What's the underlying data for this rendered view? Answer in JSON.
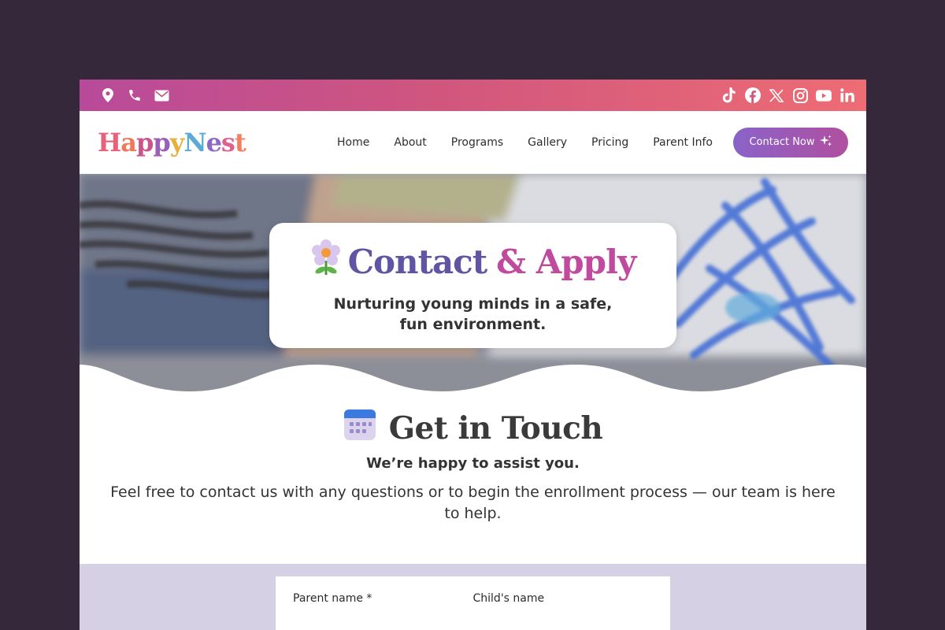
{
  "topbar": {
    "left_icons": [
      "location-pin-icon",
      "phone-icon",
      "mail-icon"
    ],
    "right_icons": [
      "tiktok-icon",
      "facebook-icon",
      "x-icon",
      "instagram-icon",
      "youtube-icon",
      "linkedin-icon"
    ]
  },
  "logo": {
    "letters": [
      "H",
      "a",
      "p",
      "p",
      "y",
      "N",
      "e",
      "s",
      "t"
    ],
    "colors": [
      "#e8607a",
      "#ee7a5a",
      "#c9558f",
      "#9a5fb8",
      "#e7b03d",
      "#5ba9d6",
      "#8b6ac6",
      "#e0608e",
      "#f08060"
    ]
  },
  "nav": {
    "items": [
      "Home",
      "About",
      "Programs",
      "Gallery",
      "Pricing",
      "Parent Info"
    ],
    "cta_label": "Contact Now",
    "cta_icon": "sparkles-icon"
  },
  "hero": {
    "icon": "flower-icon",
    "title_part1": "Contact",
    "title_part2": "& Apply",
    "subtitle": "Nurturing young minds in a safe, fun environment."
  },
  "touch": {
    "icon": "calendar-icon",
    "title": "Get in Touch",
    "subtitle": "We’re happy to assist you.",
    "body": "Feel free to contact us with any questions or to begin the enrollment process — our team is here to help."
  },
  "form": {
    "parent_label": "Parent name *",
    "child_label": "Child's name"
  },
  "colors": {
    "page_bg": "#35283a",
    "accent_purple": "#5f55a3",
    "accent_pink": "#c04a9e",
    "form_bg": "#d5d0e4"
  }
}
